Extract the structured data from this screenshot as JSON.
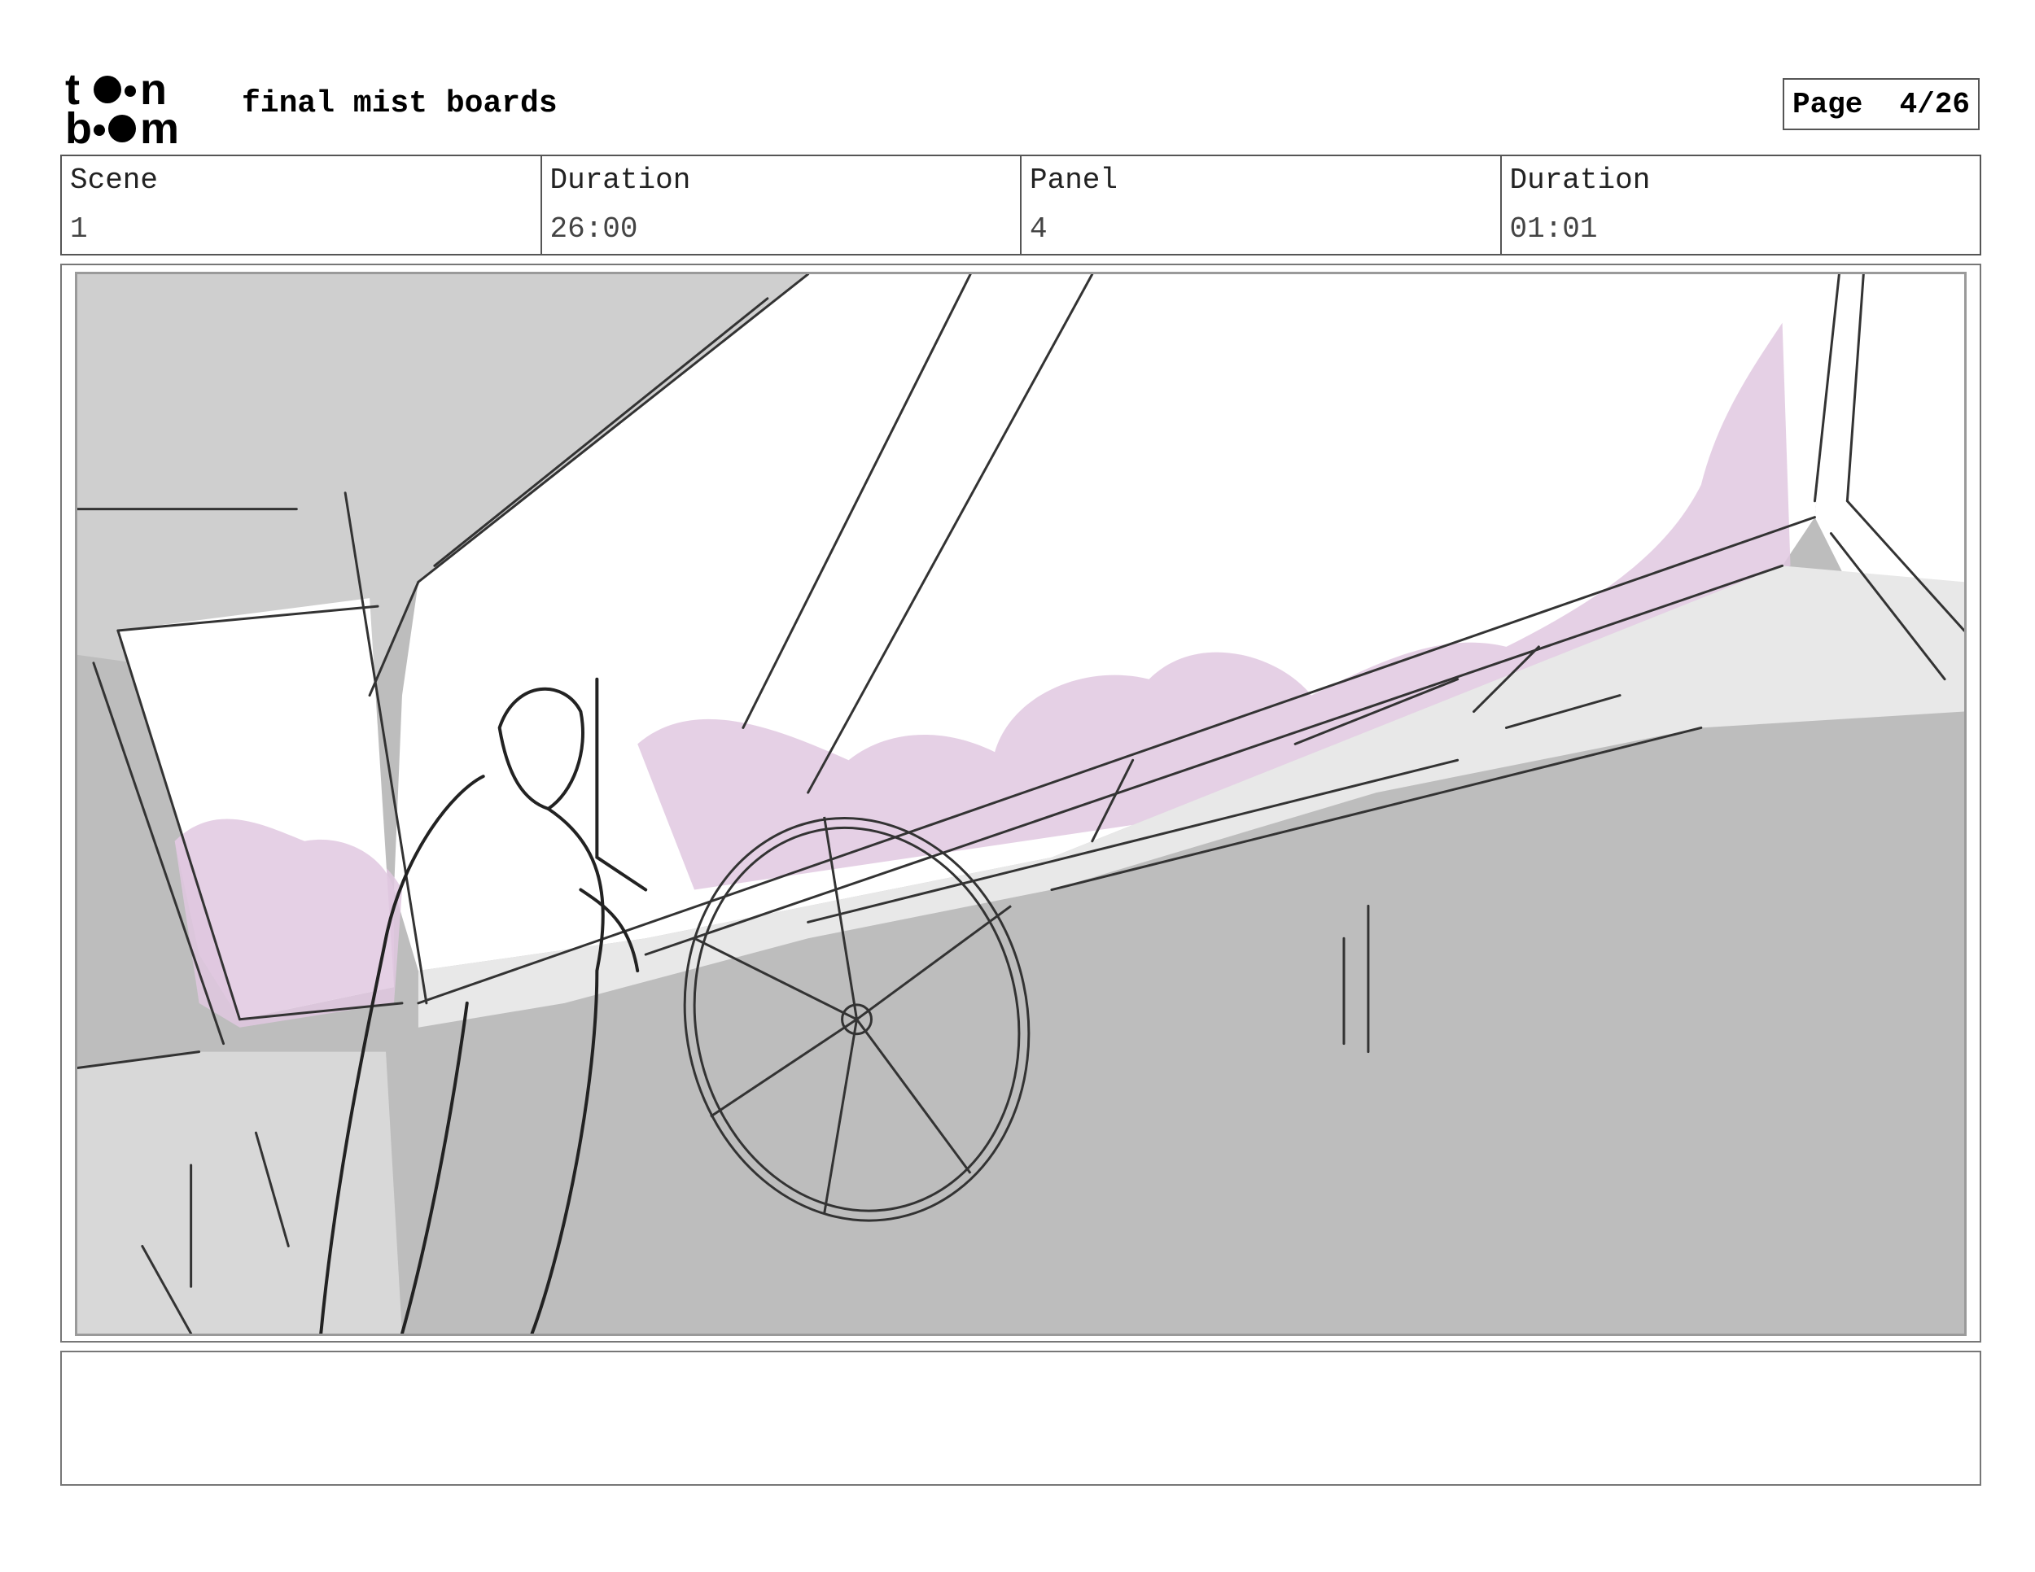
{
  "header": {
    "logo_text": "toon boom",
    "board_title": "final mist boards",
    "page_label": "Page",
    "page_value": "4/26"
  },
  "info": {
    "scene_label": "Scene",
    "scene_value": "1",
    "scene_duration_label": "Duration",
    "scene_duration_value": "26:00",
    "panel_label": "Panel",
    "panel_value": "4",
    "panel_duration_label": "Duration",
    "panel_duration_value": "01:01"
  },
  "panel": {
    "sky_accent_color": "#e0c8e0",
    "bg_color": "#bdbdbd"
  },
  "notes": {
    "text": ""
  }
}
